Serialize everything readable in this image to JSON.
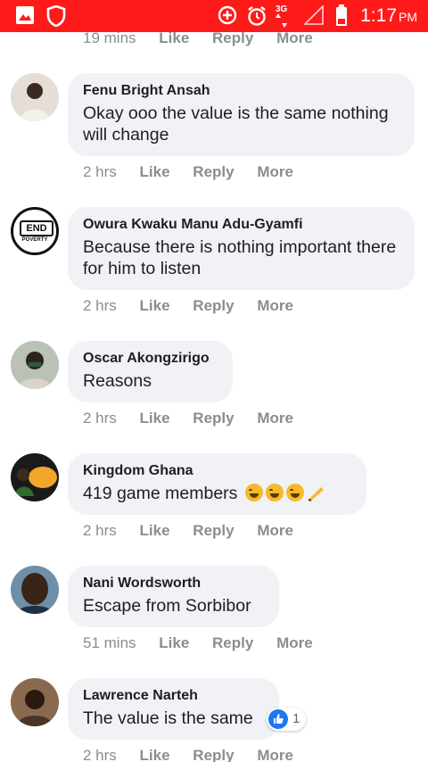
{
  "status_bar": {
    "network": "3G",
    "time": "1:17",
    "ampm": "PM",
    "background_color": "#ff1a1a"
  },
  "action_labels": {
    "like": "Like",
    "reply": "Reply",
    "more": "More"
  },
  "top_actions": {
    "time": "19 mins"
  },
  "comments": [
    {
      "name": "Fenu Bright Ansah",
      "text": "Okay ooo the value is the same nothing will change",
      "time": "2 hrs"
    },
    {
      "name": "Owura Kwaku Manu Adu-Gyamfi",
      "text": "Because there is nothing important there for him to listen",
      "time": "2 hrs",
      "avatar_text_1": "END",
      "avatar_text_2": "POVERTY"
    },
    {
      "name": "Oscar Akongzirigo",
      "text": "Reasons",
      "time": "2 hrs"
    },
    {
      "name": "Kingdom Ghana",
      "text": "419 game members",
      "time": "2 hrs",
      "emojis": [
        "laughing-emoji",
        "laughing-emoji",
        "laughing-emoji",
        "writing-hand-emoji"
      ]
    },
    {
      "name": "Nani Wordsworth",
      "text": "Escape from Sorbibor",
      "time": "51 mins"
    },
    {
      "name": "Lawrence Narteh",
      "text": "The value is the same",
      "time": "2 hrs",
      "reaction": {
        "type": "like",
        "count": "1"
      }
    }
  ]
}
